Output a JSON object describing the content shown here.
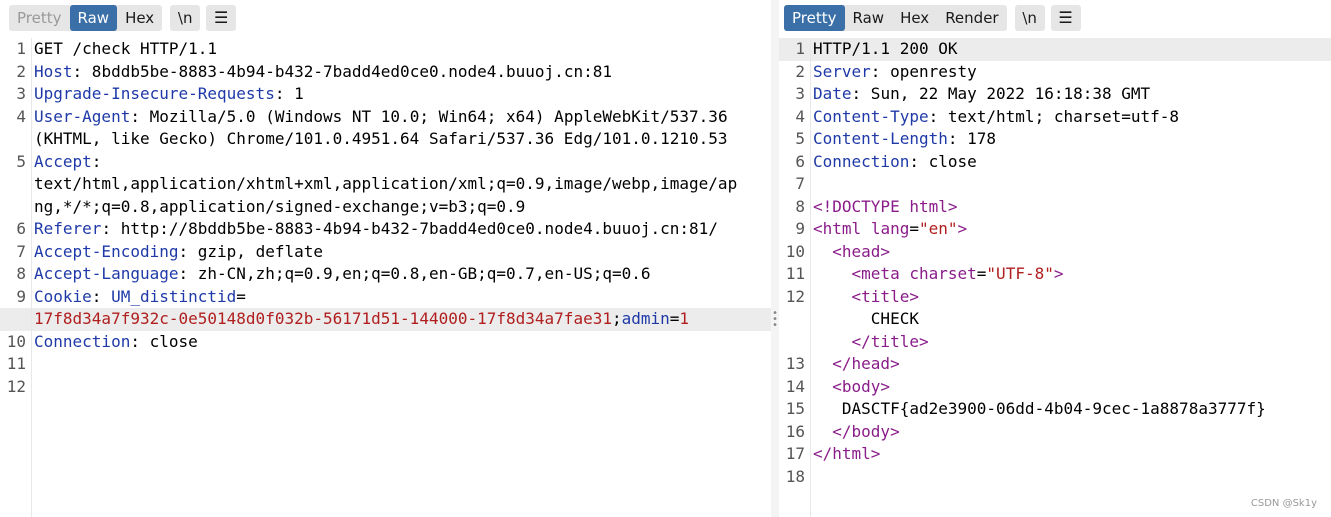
{
  "request": {
    "tabs": [
      {
        "label": "Pretty",
        "state": "inactive"
      },
      {
        "label": "Raw",
        "state": "active"
      },
      {
        "label": "Hex",
        "state": "normal"
      }
    ],
    "newline_label": "\\n",
    "menu_icon": "hamburger-icon",
    "lines": {
      "l1": "GET /check HTTP/1.1",
      "l2k": "Host",
      "l2v": " 8bddb5be-8883-4b94-b432-7badd4ed0ce0.node4.buuoj.cn:81",
      "l3k": "Upgrade-Insecure-Requests",
      "l3v": " 1",
      "l4k": "User-Agent",
      "l4v": " Mozilla/5.0 (Windows NT 10.0; Win64; x64) AppleWebKit/537.36",
      "l4c": "(KHTML, like Gecko) Chrome/101.0.4951.64 Safari/537.36 Edg/101.0.1210.53",
      "l5k": "Accept",
      "l5c1": "text/html,application/xhtml+xml,application/xml;q=0.9,image/webp,image/ap",
      "l5c2": "ng,*/*;q=0.8,application/signed-exchange;v=b3;q=0.9",
      "l6k": "Referer",
      "l6v": " http://8bddb5be-8883-4b94-b432-7badd4ed0ce0.node4.buuoj.cn:81/",
      "l7k": "Accept-Encoding",
      "l7v": " gzip, deflate",
      "l8k": "Accept-Language",
      "l8v": " zh-CN,zh;q=0.9,en;q=0.8,en-GB;q=0.7,en-US;q=0.6",
      "l9k": "Cookie",
      "l9n": " UM_distinctid",
      "l9c_val": "17f8d34a7f932c-0e50148d0f032b-56171d51-144000-17f8d34a7fae31",
      "l9c_sep": ";",
      "l9c_n2": "admin",
      "l9c_v2": "1",
      "l10k": "Connection",
      "l10v": " close"
    },
    "line_numbers": [
      "1",
      "2",
      "3",
      "4",
      "5",
      "6",
      "7",
      "8",
      "9",
      "10",
      "11",
      "12"
    ]
  },
  "response": {
    "tabs": [
      {
        "label": "Pretty",
        "state": "active"
      },
      {
        "label": "Raw",
        "state": "normal"
      },
      {
        "label": "Hex",
        "state": "normal"
      },
      {
        "label": "Render",
        "state": "normal"
      }
    ],
    "newline_label": "\\n",
    "menu_icon": "hamburger-icon",
    "lines": {
      "l1": "HTTP/1.1 200 OK",
      "l2k": "Server",
      "l2v": " openresty",
      "l3k": "Date",
      "l3v": " Sun, 22 May 2022 16:18:38 GMT",
      "l4k": "Content-Type",
      "l4v": " text/html; charset=utf-8",
      "l5k": "Content-Length",
      "l5v": " 178",
      "l6k": "Connection",
      "l6v": " close",
      "l8": "<!DOCTYPE html>",
      "l9_open": "<html",
      "l9_attr": "lang",
      "l9_val": "\"en\"",
      "l9_close": ">",
      "l10": "<head>",
      "l11_open": "<meta",
      "l11_attr": "charset",
      "l11_val": "\"UTF-8\"",
      "l11_close": ">",
      "l12": "<title>",
      "l12c1": "CHECK",
      "l12c2": "</title>",
      "l13": "</head>",
      "l14": "<body>",
      "l15": "DASCTF{ad2e3900-06dd-4b04-9cec-1a8878a3777f}",
      "l16": "</body>",
      "l17": "</html>"
    },
    "line_numbers": [
      "1",
      "2",
      "3",
      "4",
      "5",
      "6",
      "7",
      "8",
      "9",
      "10",
      "11",
      "12",
      "13",
      "14",
      "15",
      "16",
      "17",
      "18"
    ]
  },
  "watermark": "CSDN @Sk1y"
}
